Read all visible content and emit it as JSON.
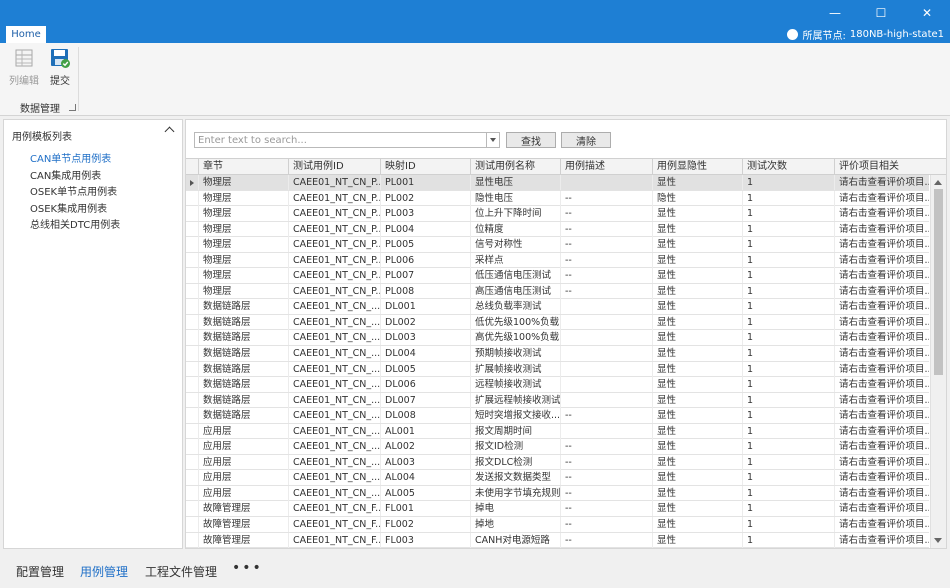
{
  "window": {
    "minimize_glyph": "—",
    "maximize_glyph": "☐",
    "close_glyph": "✕"
  },
  "tabs": {
    "home": "Home"
  },
  "node": {
    "label": "所属节点:",
    "value": "180NB-high-state1"
  },
  "ribbon": {
    "edit_label": "列编辑",
    "submit_label": "提交",
    "group_label": "数据管理"
  },
  "left_panel": {
    "title": "用例模板列表",
    "items": [
      {
        "label": "CAN单节点用例表",
        "active": true
      },
      {
        "label": "CAN集成用例表",
        "active": false
      },
      {
        "label": "OSEK单节点用例表",
        "active": false
      },
      {
        "label": "OSEK集成用例表",
        "active": false
      },
      {
        "label": "总线相关DTC用例表",
        "active": false
      }
    ]
  },
  "search": {
    "placeholder": "Enter text to search...",
    "find_label": "查找",
    "clear_label": "清除"
  },
  "table": {
    "columns": [
      "章节",
      "测试用例ID",
      "映射ID",
      "测试用例名称",
      "用例描述",
      "用例显隐性",
      "测试次数",
      "评价项目相关"
    ],
    "rows": [
      [
        "物理层",
        "CAEE01_NT_CN_P...",
        "PL001",
        "显性电压",
        "",
        "显性",
        "1",
        "请右击查看评价项目..."
      ],
      [
        "物理层",
        "CAEE01_NT_CN_P...",
        "PL002",
        "隐性电压",
        "--",
        "隐性",
        "1",
        "请右击查看评价项目..."
      ],
      [
        "物理层",
        "CAEE01_NT_CN_P...",
        "PL003",
        "位上升下降时间",
        "--",
        "显性",
        "1",
        "请右击查看评价项目..."
      ],
      [
        "物理层",
        "CAEE01_NT_CN_P...",
        "PL004",
        "位精度",
        "--",
        "显性",
        "1",
        "请右击查看评价项目..."
      ],
      [
        "物理层",
        "CAEE01_NT_CN_P...",
        "PL005",
        "信号对称性",
        "--",
        "显性",
        "1",
        "请右击查看评价项目..."
      ],
      [
        "物理层",
        "CAEE01_NT_CN_P...",
        "PL006",
        "采样点",
        "--",
        "显性",
        "1",
        "请右击查看评价项目..."
      ],
      [
        "物理层",
        "CAEE01_NT_CN_P...",
        "PL007",
        "低压通信电压测试",
        "--",
        "显性",
        "1",
        "请右击查看评价项目..."
      ],
      [
        "物理层",
        "CAEE01_NT_CN_P...",
        "PL008",
        "高压通信电压测试",
        "--",
        "显性",
        "1",
        "请右击查看评价项目..."
      ],
      [
        "数据链路层",
        "CAEE01_NT_CN_...",
        "DL001",
        "总线负载率测试",
        "",
        "显性",
        "1",
        "请右击查看评价项目..."
      ],
      [
        "数据链路层",
        "CAEE01_NT_CN_...",
        "DL002",
        "低优先级100%负载...",
        "",
        "显性",
        "1",
        "请右击查看评价项目..."
      ],
      [
        "数据链路层",
        "CAEE01_NT_CN_...",
        "DL003",
        "高优先级100%负载...",
        "",
        "显性",
        "1",
        "请右击查看评价项目..."
      ],
      [
        "数据链路层",
        "CAEE01_NT_CN_...",
        "DL004",
        "预期帧接收测试",
        "",
        "显性",
        "1",
        "请右击查看评价项目..."
      ],
      [
        "数据链路层",
        "CAEE01_NT_CN_...",
        "DL005",
        "扩展帧接收测试",
        "",
        "显性",
        "1",
        "请右击查看评价项目..."
      ],
      [
        "数据链路层",
        "CAEE01_NT_CN_...",
        "DL006",
        "远程帧接收测试",
        "",
        "显性",
        "1",
        "请右击查看评价项目..."
      ],
      [
        "数据链路层",
        "CAEE01_NT_CN_...",
        "DL007",
        "扩展远程帧接收测试",
        "",
        "显性",
        "1",
        "请右击查看评价项目..."
      ],
      [
        "数据链路层",
        "CAEE01_NT_CN_...",
        "DL008",
        "短时突增报文接收...",
        "--",
        "显性",
        "1",
        "请右击查看评价项目..."
      ],
      [
        "应用层",
        "CAEE01_NT_CN_...",
        "AL001",
        "报文周期时间",
        "",
        "显性",
        "1",
        "请右击查看评价项目..."
      ],
      [
        "应用层",
        "CAEE01_NT_CN_...",
        "AL002",
        "报文ID检测",
        "--",
        "显性",
        "1",
        "请右击查看评价项目..."
      ],
      [
        "应用层",
        "CAEE01_NT_CN_...",
        "AL003",
        "报文DLC检测",
        "--",
        "显性",
        "1",
        "请右击查看评价项目..."
      ],
      [
        "应用层",
        "CAEE01_NT_CN_...",
        "AL004",
        "发送报文数据类型",
        "--",
        "显性",
        "1",
        "请右击查看评价项目..."
      ],
      [
        "应用层",
        "CAEE01_NT_CN_...",
        "AL005",
        "未使用字节填充规则",
        "--",
        "显性",
        "1",
        "请右击查看评价项目..."
      ],
      [
        "故障管理层",
        "CAEE01_NT_CN_F...",
        "FL001",
        "掉电",
        "--",
        "显性",
        "1",
        "请右击查看评价项目..."
      ],
      [
        "故障管理层",
        "CAEE01_NT_CN_F...",
        "FL002",
        "掉地",
        "--",
        "显性",
        "1",
        "请右击查看评价项目..."
      ],
      [
        "故障管理层",
        "CAEE01_NT_CN_F...",
        "FL003",
        "CANH对电源短路",
        "--",
        "显性",
        "1",
        "请右击查看评价项目..."
      ]
    ]
  },
  "bottom_tabs": [
    {
      "label": "配置管理",
      "active": false
    },
    {
      "label": "用例管理",
      "active": true
    },
    {
      "label": "工程文件管理",
      "active": false
    },
    {
      "label": "•••",
      "active": false
    }
  ]
}
